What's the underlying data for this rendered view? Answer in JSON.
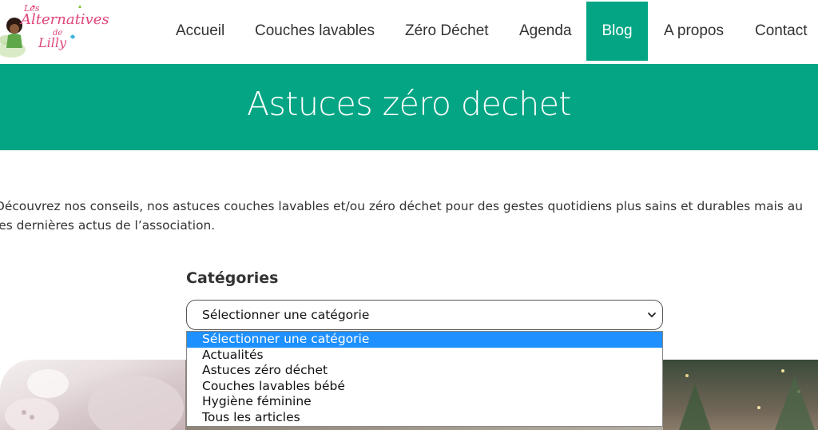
{
  "logo": {
    "line1": "Les",
    "line2": "Alternatives",
    "line3": "de",
    "line4": "Lilly"
  },
  "nav": {
    "items": [
      {
        "label": "Accueil",
        "active": false
      },
      {
        "label": "Couches lavables",
        "active": false
      },
      {
        "label": "Zéro Déchet",
        "active": false
      },
      {
        "label": "Agenda",
        "active": false
      },
      {
        "label": "Blog",
        "active": true
      },
      {
        "label": "A propos",
        "active": false
      },
      {
        "label": "Contact",
        "active": false
      }
    ]
  },
  "hero": {
    "title": "Astuces zéro dechet"
  },
  "intro": {
    "line1": "Découvrez nos conseils, nos astuces couches lavables et/ou zéro déchet pour des gestes quotidiens plus sains et durables mais au",
    "line2": "les dernières actus de l’association."
  },
  "categories": {
    "title": "Catégories",
    "selected": "Sélectionner une catégorie",
    "options": [
      "Sélectionner une catégorie",
      "Actualités",
      "Astuces zéro déchet",
      "Couches lavables bébé",
      "Hygiène féminine",
      "Tous les articles"
    ]
  },
  "colors": {
    "brand_green": "#04a584",
    "option_highlight": "#1e90ff"
  }
}
